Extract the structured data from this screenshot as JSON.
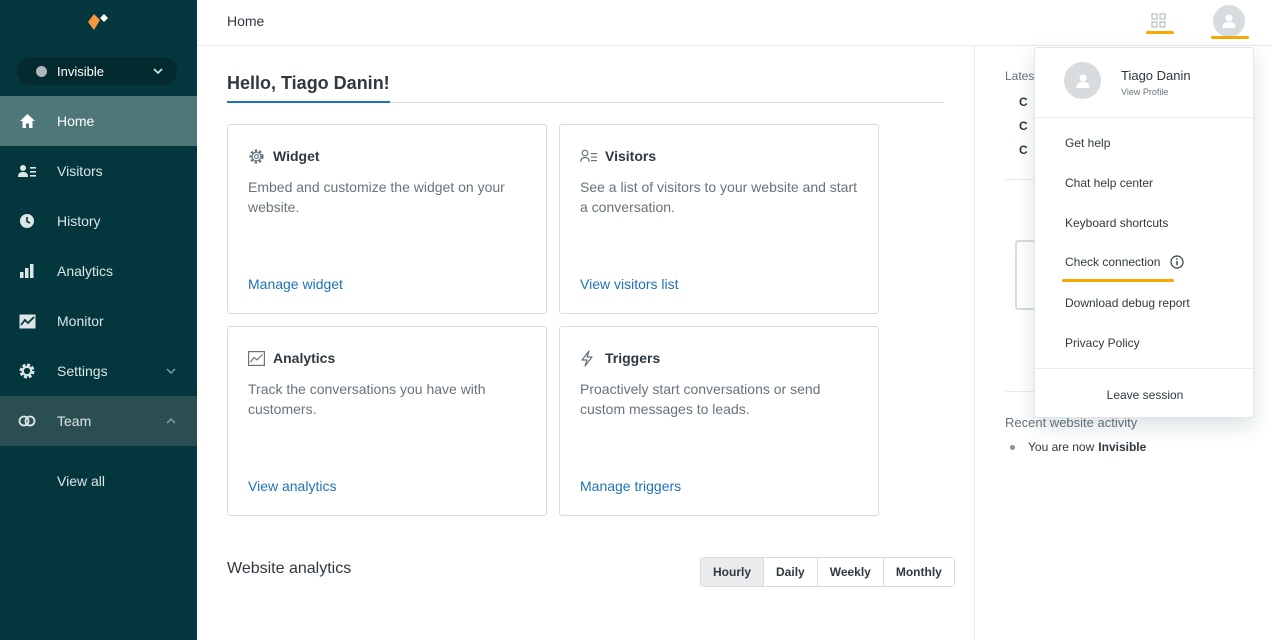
{
  "sidebar": {
    "status": {
      "label": "Invisible"
    },
    "nav": [
      {
        "label": "Home",
        "icon": "home-icon"
      },
      {
        "label": "Visitors",
        "icon": "visitors-icon"
      },
      {
        "label": "History",
        "icon": "history-icon"
      },
      {
        "label": "Analytics",
        "icon": "analytics-icon"
      },
      {
        "label": "Monitor",
        "icon": "monitor-icon"
      },
      {
        "label": "Settings",
        "icon": "gear-icon"
      },
      {
        "label": "Team",
        "icon": "team-icon"
      }
    ],
    "team_sub": {
      "label": "View all"
    }
  },
  "header": {
    "title": "Home"
  },
  "main": {
    "greeting": "Hello, Tiago Danin!",
    "cards": [
      {
        "title": "Widget",
        "description": "Embed and customize the widget on your website.",
        "link": "Manage widget",
        "icon": "gear-icon"
      },
      {
        "title": "Visitors",
        "description": "See a list of visitors to your website and start a conversation.",
        "link": "View visitors list",
        "icon": "visitors-icon"
      },
      {
        "title": "Analytics",
        "description": "Track the conversations you have with customers.",
        "link": "View analytics",
        "icon": "analytics-chart-icon"
      },
      {
        "title": "Triggers",
        "description": "Proactively start conversations or send custom messages to leads.",
        "link": "Manage triggers",
        "icon": "lightning-icon"
      }
    ],
    "website_analytics": {
      "title": "Website analytics",
      "periods": [
        "Hourly",
        "Daily",
        "Weekly",
        "Monthly"
      ],
      "selected": "Hourly"
    }
  },
  "right_panel": {
    "latest_label": "Lates",
    "latest_rows": [
      "C",
      "C",
      "C"
    ],
    "recent_title": "Recent website activity",
    "recent_item_prefix": "You are now",
    "recent_item_status": "Invisible"
  },
  "dropdown": {
    "name": "Tiago Danin",
    "view_profile": "View Profile",
    "items": [
      "Get help",
      "Chat help center",
      "Keyboard shortcuts",
      "Check connection",
      "Download debug report",
      "Privacy Policy"
    ],
    "leave": "Leave session"
  },
  "colors": {
    "sidebar_bg": "#03363d",
    "active_nav": "#4f777a",
    "link": "#1f73b7",
    "annotation": "#f4a900"
  }
}
